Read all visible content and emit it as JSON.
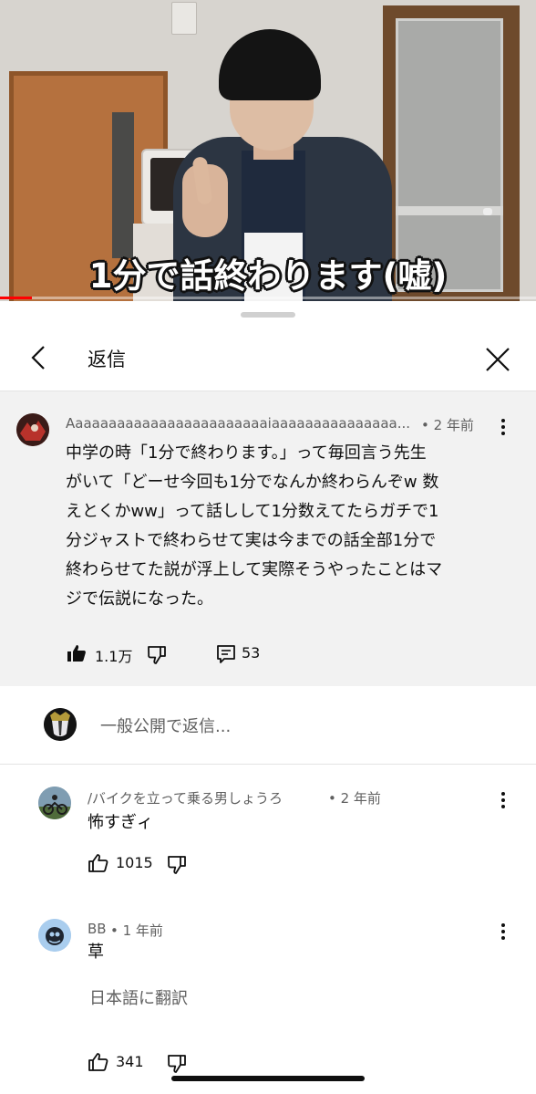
{
  "video": {
    "caption": "1分で話終わります(嘘)",
    "progress": 0.06
  },
  "sheet": {
    "title": "返信",
    "back_icon": "chevron-left-icon",
    "close_icon": "close-icon"
  },
  "parent_comment": {
    "author": "Aaaaaaaaaaaaaaaaaaaaaaaaiaaaaaaaaaaaaaaa...",
    "time": "• 2 年前",
    "lines": [
      "中学の時「1分で終わります。」って毎回言う先生",
      "がいて「どーせ今回も1分でなんか終わらんぞw 数",
      "えとくかww」って話しして1分数えてたらガチで1",
      "分ジャストで終わらせて実は今までの話全部1分で",
      "終わらせてた説が浮上して実際そうやったことはマ",
      "ジで伝説になった。"
    ],
    "likes": "1.1万",
    "replies": "53"
  },
  "reply_input": {
    "placeholder": "一般公開で返信..."
  },
  "replies": [
    {
      "author": "/バイクを立って乗る男しょうろ",
      "time": "• 2 年前",
      "text": "怖すぎィ",
      "likes": "1015"
    },
    {
      "author": "BB",
      "time": "• 1 年前",
      "text": "草",
      "translate": "日本語に翻訳",
      "likes": "341"
    }
  ],
  "colors": {
    "accent_red": "#ff0000",
    "secondary_text": "#606060",
    "parent_bg": "#f2f2f2"
  }
}
